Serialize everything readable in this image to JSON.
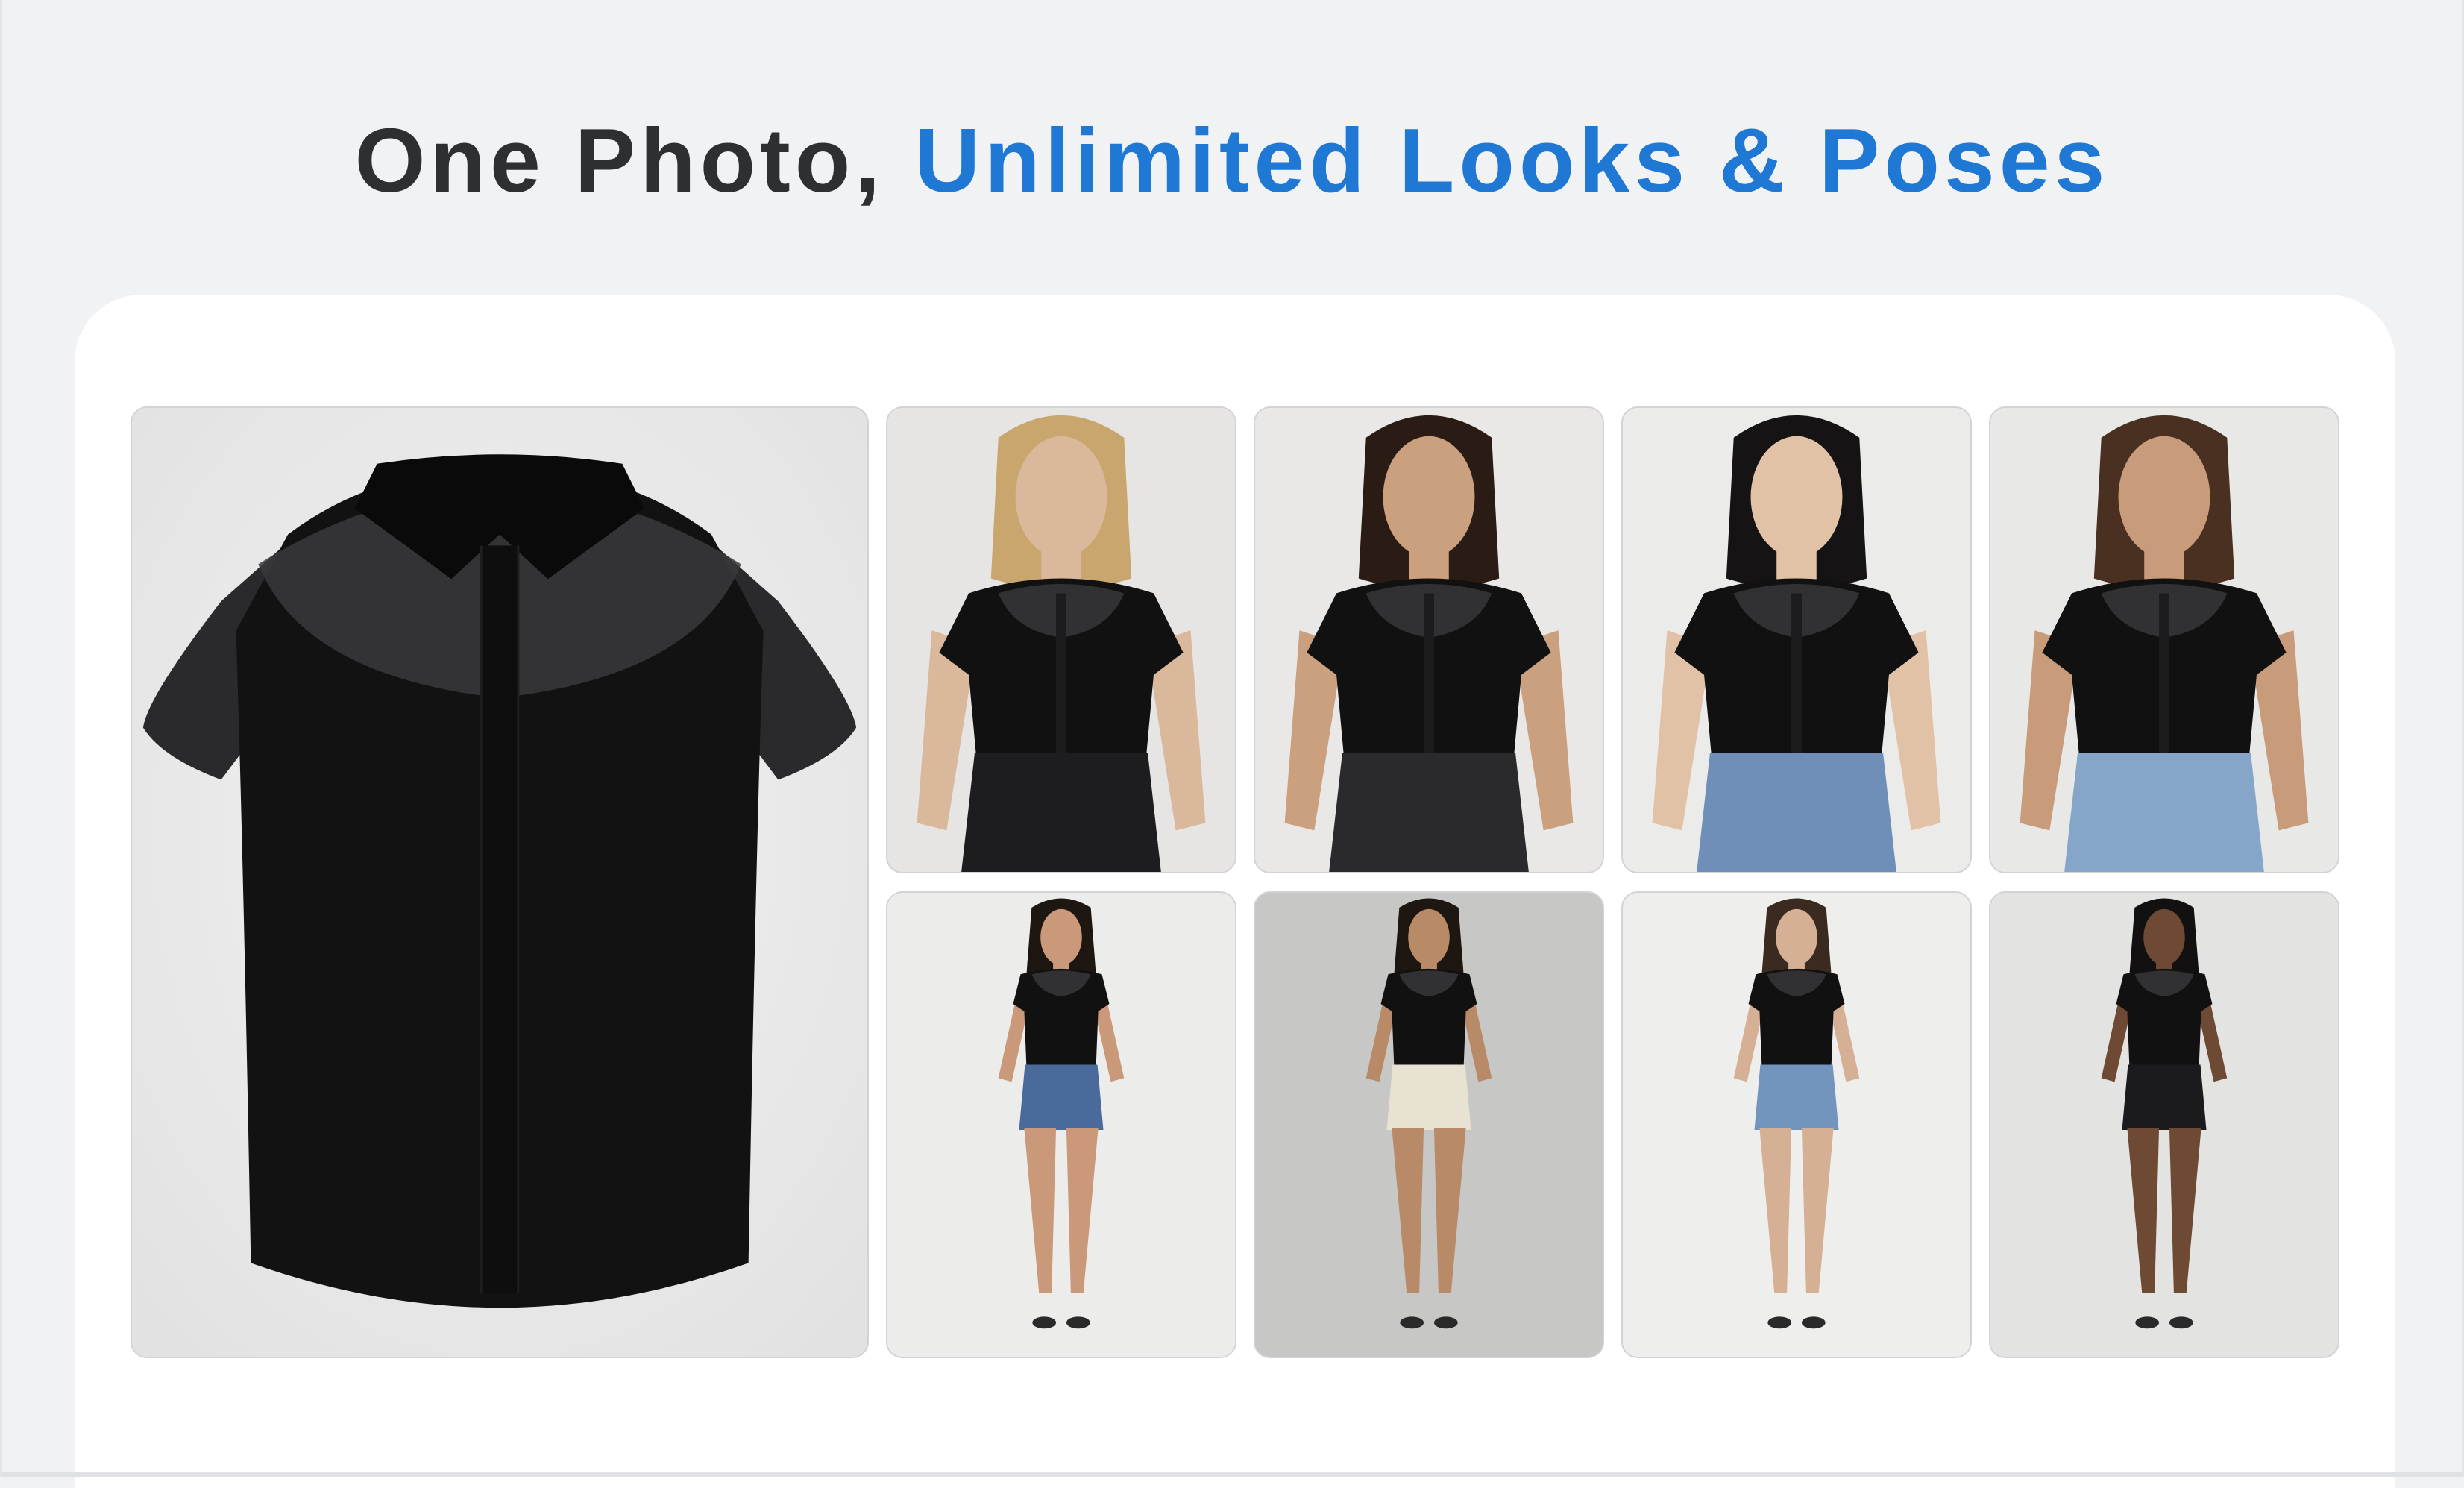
{
  "headline": {
    "part1": "One Photo, ",
    "part2": "Unlimited Looks & Poses"
  },
  "colors": {
    "page_background": "#f1f2f4",
    "headline_dark": "#2e2f31",
    "headline_accent": "#1e78d4",
    "card_background": "#ffffff",
    "tile_border": "#d2d3d6"
  },
  "gallery": {
    "product_image": {
      "subject": "black sheer cap-sleeve collared blouse flat lay"
    },
    "model_images": [
      {
        "subject": "blonde model, black top, black leather shorts",
        "bottom": "#1d1d1f",
        "skin": "#d9b89c",
        "hair": "#c9a66d",
        "bg": "#e6e5e3"
      },
      {
        "subject": "brunette model, black top, black shorts",
        "bottom": "#2a2a2c",
        "skin": "#caa07e",
        "hair": "#2a1c14",
        "bg": "#e9e8e6"
      },
      {
        "subject": "dark-haired model, black top, blue jeans",
        "bottom": "#6f8fb8",
        "skin": "#e2c2a6",
        "hair": "#151313",
        "bg": "#ebebea"
      },
      {
        "subject": "long-haired model, black top, light jeans",
        "bottom": "#86a6c9",
        "skin": "#c89c7a",
        "hair": "#4a3020",
        "bg": "#e8e8e7"
      },
      {
        "subject": "full-body model, black top, denim shorts",
        "bottom": "#4b6a9c",
        "skin": "#c9997a",
        "hair": "#1e1610",
        "bg": "#ececeb"
      },
      {
        "subject": "full-body model, black top, cream shorts",
        "bottom": "#e8e2d2",
        "skin": "#b88a68",
        "hair": "#1e1610",
        "bg": "#c7c7c5"
      },
      {
        "subject": "full-body model, black top, denim shorts",
        "bottom": "#7394bd",
        "skin": "#d6b094",
        "hair": "#3b2a1f",
        "bg": "#eeeeed"
      },
      {
        "subject": "full-body model, black top, black shorts",
        "bottom": "#1b1b1d",
        "skin": "#6e4a34",
        "hair": "#121010",
        "bg": "#e3e3e2"
      }
    ]
  }
}
